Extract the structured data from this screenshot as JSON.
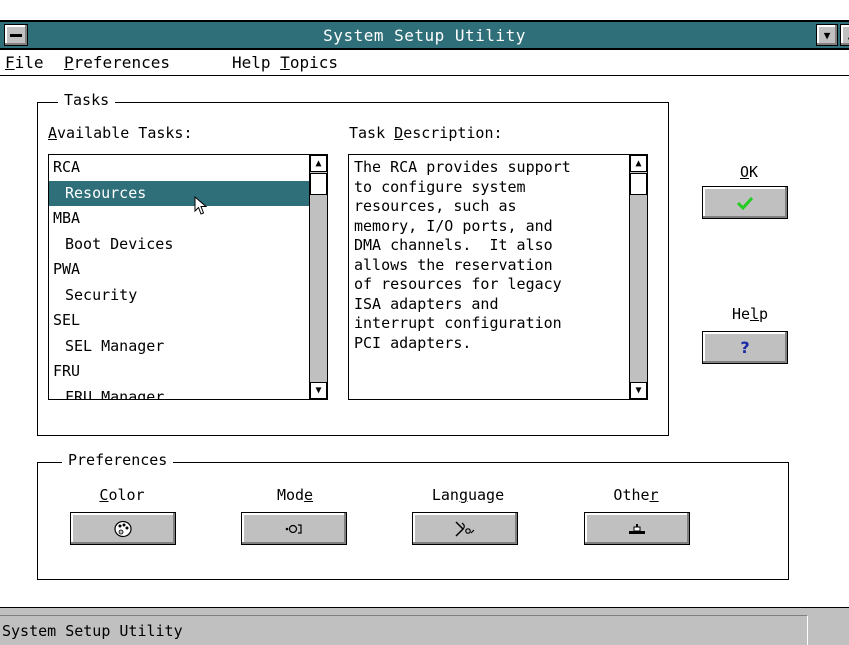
{
  "window": {
    "title": "System Setup Utility"
  },
  "menu": {
    "items": [
      {
        "prefix": "",
        "underline": "F",
        "rest": "ile"
      },
      {
        "prefix": "",
        "underline": "P",
        "rest": "references"
      },
      {
        "prefix": "Help ",
        "underline": "T",
        "rest": "opics"
      }
    ]
  },
  "tasks": {
    "group_label": "Tasks",
    "available_label_u": "A",
    "available_label_rest": "vailable Tasks:",
    "description_label_pre": "Task ",
    "description_label_u": "D",
    "description_label_rest": "escription:",
    "list": [
      {
        "label": "RCA",
        "indent": false,
        "selected": false
      },
      {
        "label": "Resources",
        "indent": true,
        "selected": true
      },
      {
        "label": "MBA",
        "indent": false,
        "selected": false
      },
      {
        "label": "Boot Devices",
        "indent": true,
        "selected": false
      },
      {
        "label": "PWA",
        "indent": false,
        "selected": false
      },
      {
        "label": "Security",
        "indent": true,
        "selected": false
      },
      {
        "label": "SEL",
        "indent": false,
        "selected": false
      },
      {
        "label": "SEL Manager",
        "indent": true,
        "selected": false
      },
      {
        "label": "FRU",
        "indent": false,
        "selected": false
      },
      {
        "label": "FRU Manager",
        "indent": true,
        "selected": false
      }
    ],
    "description": "The RCA provides support\nto configure system\nresources, such as\nmemory, I/O ports, and\nDMA channels.  It also\nallows the reservation\nof resources for legacy\nISA adapters and\ninterrupt configuration\nPCI adapters."
  },
  "buttons": {
    "ok_u": "O",
    "ok_rest": "K",
    "help_pre": "He",
    "help_u": "l",
    "help_rest": "p",
    "help_glyph": "?",
    "ok_icon": "checkmark-icon",
    "help_icon": "question-icon"
  },
  "preferences": {
    "group_label": "Preferences",
    "items": [
      {
        "pre": "",
        "u": "C",
        "rest": "olor",
        "icon": "palette-icon"
      },
      {
        "pre": "Mod",
        "u": "e",
        "rest": "",
        "icon": "mode-icon"
      },
      {
        "pre": "Lan",
        "u": "g",
        "rest": "uage",
        "icon": "language-icon"
      },
      {
        "pre": "Othe",
        "u": "r",
        "rest": "",
        "icon": "other-icon"
      }
    ]
  },
  "status": {
    "text": "System Setup Utility"
  },
  "colors": {
    "titlebar": "#2f6f79",
    "selection": "#2f6f79",
    "checkmark": "#22cc22",
    "help_q": "#1a2aa8"
  }
}
